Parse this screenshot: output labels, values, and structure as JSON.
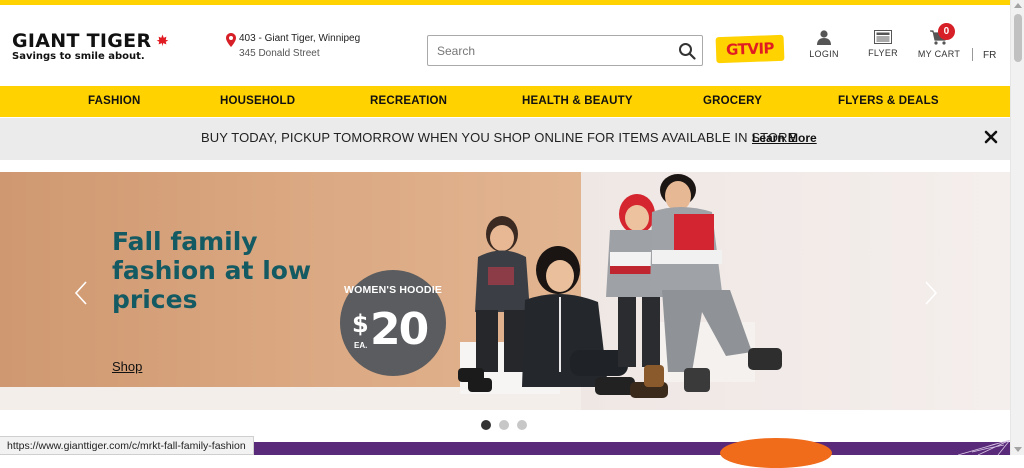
{
  "header": {
    "logo_name": "GIANT TIGER",
    "logo_tagline": "Savings to smile about.",
    "store_line1": "403 - Giant Tiger, Winnipeg",
    "store_line2": "345 Donald Street",
    "search_placeholder": "Search",
    "search_value": "",
    "gtvip_label": "GTVIP",
    "login_label": "LOGIN",
    "flyer_label": "FLYER",
    "cart_label": "MY CART",
    "cart_count": "0",
    "language_label": "FR"
  },
  "nav": {
    "items": [
      "FASHION",
      "HOUSEHOLD",
      "RECREATION",
      "HEALTH & BEAUTY",
      "GROCERY",
      "FLYERS & DEALS"
    ]
  },
  "promo": {
    "message": "BUY TODAY, PICKUP TOMORROW WHEN YOU SHOP ONLINE FOR ITEMS AVAILABLE IN STORE",
    "link_label": "Learn More"
  },
  "hero": {
    "title": "Fall family fashion at low prices",
    "cta_label": "Shop",
    "price_badge_label": "WOMEN'S HOODIE",
    "price_dollar_sign": "$",
    "price_amount": "20",
    "price_unit": "EA.",
    "active_slide": 1,
    "slide_count": 3
  },
  "status_bar": {
    "url": "https://www.gianttiger.com/c/mrkt-fall-family-fashion"
  },
  "colors": {
    "brand_yellow": "#ffd200",
    "brand_red": "#e11b22",
    "hero_title": "#145a63",
    "promo_bg": "#ebebeb"
  },
  "icons": {
    "store": "map-pin-icon",
    "search": "search-icon",
    "login": "user-icon",
    "flyer": "newspaper-icon",
    "cart": "shopping-cart-icon",
    "close": "close-icon",
    "prev": "chevron-left-icon",
    "next": "chevron-right-icon"
  }
}
